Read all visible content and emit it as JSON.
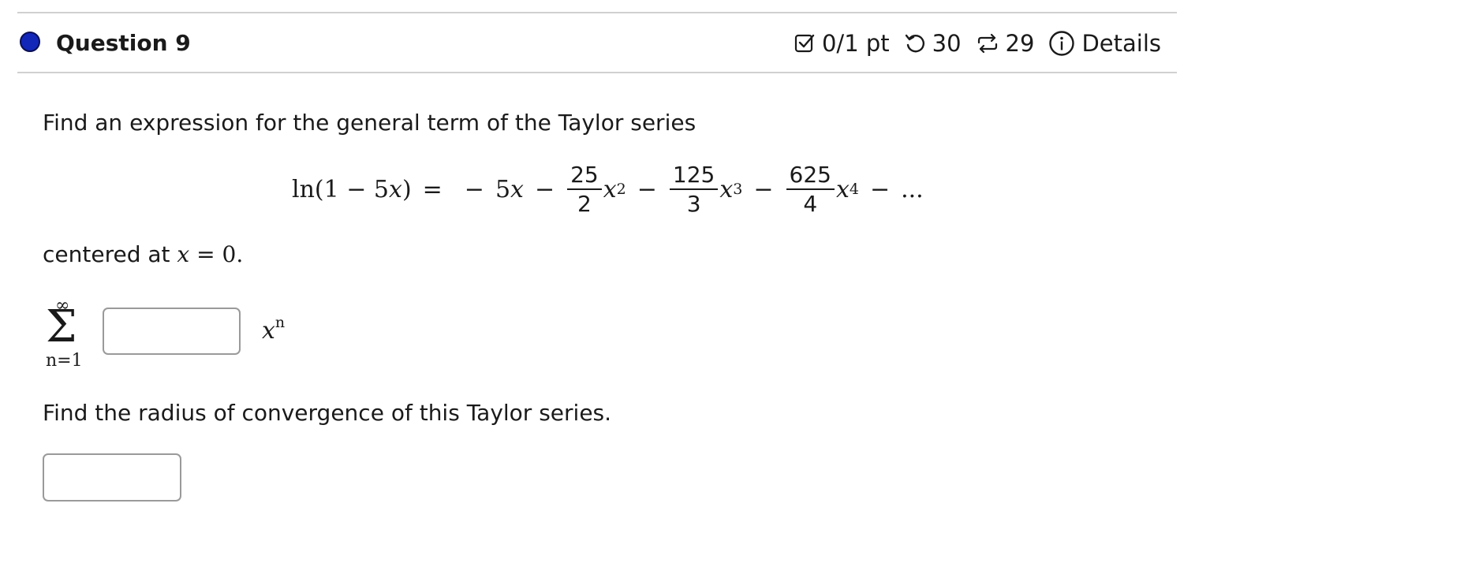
{
  "question": {
    "title": "Question 9",
    "status_color": "#1226b8",
    "score": "0/1 pt",
    "retries": "30",
    "attempts": "29",
    "details_label": "Details",
    "icons": [
      "checkbox-check-icon",
      "undo-icon",
      "repeat-icon",
      "info-icon"
    ]
  },
  "prompt": {
    "line1": "Find an expression for the general term of the Taylor series",
    "centered_prefix": "centered at",
    "centered_var": "x",
    "centered_eq": "=",
    "centered_val": "0.",
    "line3": "Find the radius of convergence of this Taylor series."
  },
  "equation": {
    "lhs_fn": "ln",
    "lhs_open": "(1 − 5",
    "lhs_var": "x",
    "lhs_close": ")",
    "equals": "=",
    "t1_sign": "−",
    "t1_coef": "5",
    "var": "x",
    "minus": "−",
    "frac1_num": "25",
    "frac1_den": "2",
    "pow1": "2",
    "frac2_num": "125",
    "frac2_den": "3",
    "pow2": "3",
    "frac3_num": "625",
    "frac3_den": "4",
    "pow3": "4",
    "ellipsis": "..."
  },
  "series": {
    "upper": "∞",
    "symbol": "Σ",
    "lower": "n=1",
    "var": "x",
    "power": "n"
  }
}
